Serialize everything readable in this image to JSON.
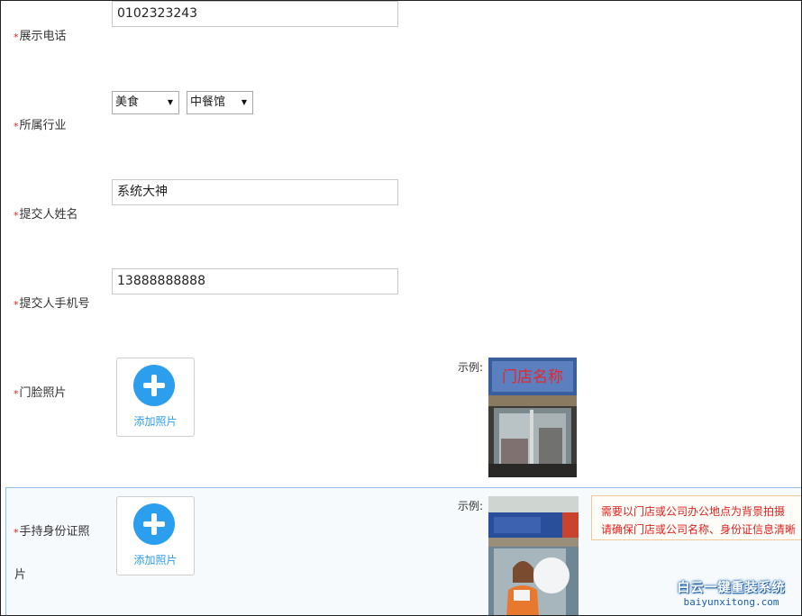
{
  "form": {
    "phone": {
      "label": "展示电话",
      "value": "0102323243"
    },
    "industry": {
      "label": "所属行业",
      "primary": "美食",
      "secondary": "中餐馆"
    },
    "submitter_name": {
      "label": "提交人姓名",
      "value": "系统大神"
    },
    "submitter_mobile": {
      "label": "提交人手机号",
      "value": "13888888888"
    },
    "storefront_photo": {
      "label": "门脸照片",
      "upload_label": "添加照片",
      "example_label": "示例:",
      "example_sign_text": "门店名称"
    },
    "id_photo": {
      "label_line1": "手持身份证照",
      "label_line2": "片",
      "upload_label": "添加照片",
      "example_label": "示例:",
      "tip_line1": "需要以门店或公司办公地点为背景拍摄",
      "tip_line2": "请确保门店或公司名称、身份证信息清晰"
    }
  },
  "required_marker": "*",
  "colors": {
    "accent": "#2c9eee",
    "required": "#e02020"
  },
  "watermark": {
    "cn": "白云一键重装系统",
    "en": "baiyunxitong.com"
  }
}
